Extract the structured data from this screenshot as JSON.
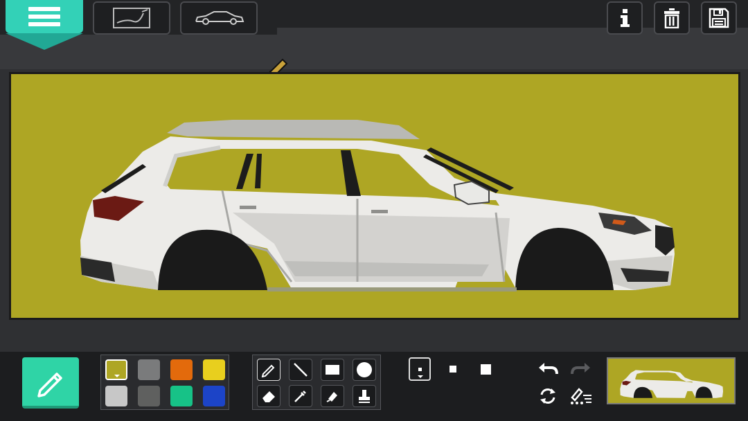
{
  "topbar": {
    "menu_icon": "hamburger-icon",
    "tabs": [
      {
        "name": "sketch-tab",
        "icon": "sketch-icon"
      },
      {
        "name": "car-tab",
        "icon": "car-outline-icon"
      }
    ],
    "actions": [
      {
        "name": "info-button",
        "icon": "info-icon"
      },
      {
        "name": "delete-button",
        "icon": "trash-icon"
      },
      {
        "name": "save-button",
        "icon": "save-icon"
      }
    ]
  },
  "canvas": {
    "background_color": "#aea624"
  },
  "toolbar": {
    "active_tool_icon": "pencil-icon",
    "active_tool_color": "#2fd4a6",
    "palette": [
      "#aea624",
      "#7a7b7c",
      "#e36a0c",
      "#e8cf1e",
      "#c7c7c7",
      "#5f605f",
      "#17c287",
      "#1c44c7"
    ],
    "selected_color_index": 0,
    "tools": [
      "pencil-icon",
      "line-icon",
      "rectangle-icon",
      "circle-icon",
      "eraser-icon",
      "eyedropper-icon",
      "bucket-fill-icon",
      "stamp-icon"
    ],
    "brush_sizes": [
      "small",
      "medium",
      "large"
    ],
    "selected_brush_size": 0,
    "history": [
      "undo-icon",
      "redo-icon",
      "rotate-icon",
      "spray-icon"
    ]
  }
}
